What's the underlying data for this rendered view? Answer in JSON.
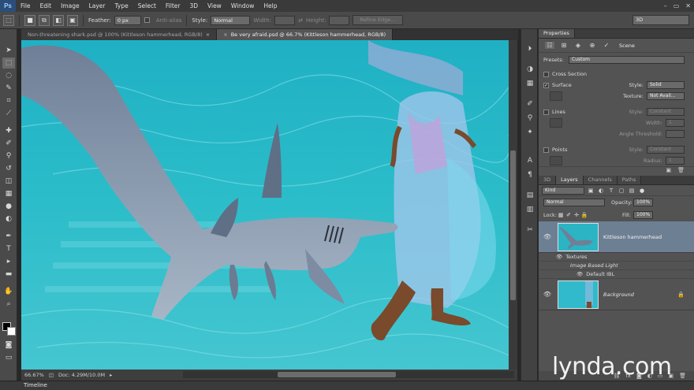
{
  "app": {
    "logo": "Ps"
  },
  "menu": [
    "File",
    "Edit",
    "Image",
    "Layer",
    "Type",
    "Select",
    "Filter",
    "3D",
    "View",
    "Window",
    "Help"
  ],
  "window_controls": [
    "–",
    "▭",
    "✕"
  ],
  "options": {
    "feather_label": "Feather:",
    "feather_value": "0 px",
    "antialias_label": "Anti-alias",
    "style_label": "Style:",
    "style_value": "Normal",
    "width_label": "Width:",
    "height_label": "Height:",
    "refine_edge": "Refine Edge...",
    "workspace": "3D"
  },
  "tabs": [
    {
      "label": "Non-threatening shark.psd @ 100% (Kittleson hammerhead, RGB/8)",
      "active": false
    },
    {
      "label": "Be very afraid.psd @ 66.7% (Kittleson hammerhead, RGB/8)",
      "active": true
    }
  ],
  "status": {
    "zoom": "66.67%",
    "doc": "Doc: 4.29M/10.0M"
  },
  "timeline_label": "Timeline",
  "properties": {
    "tab": "Properties",
    "mode_label": "Scene",
    "presets_label": "Presets:",
    "presets_value": "Custom",
    "cross_section": "Cross Section",
    "surface": "Surface",
    "surface_style_label": "Style:",
    "surface_style_value": "Solid",
    "texture_label": "Texture:",
    "texture_value": "Not Avail...",
    "lines": "Lines",
    "lines_style_label": "Style:",
    "lines_style_value": "Constant",
    "lines_width_label": "Width:",
    "lines_width_value": "1",
    "angle_threshold_label": "Angle Threshold:",
    "points": "Points",
    "points_style_label": "Style:",
    "points_style_value": "Constant",
    "points_radius_label": "Radius:",
    "points_radius_value": "1"
  },
  "layers_panel": {
    "tabs": [
      "3D",
      "Layers",
      "Channels",
      "Paths"
    ],
    "active_tab": "Layers",
    "filter_kind": "Kind",
    "blend_mode": "Normal",
    "opacity_label": "Opacity:",
    "opacity_value": "100%",
    "lock_label": "Lock:",
    "fill_label": "Fill:",
    "fill_value": "100%",
    "layers": [
      {
        "name": "Kittleson hammerhead",
        "selected": true
      },
      {
        "name": "Background",
        "selected": false
      }
    ],
    "sublayers": {
      "textures": "Textures",
      "ibl": "Image Based Light",
      "default_ibl": "Default IBL"
    }
  },
  "watermark": "lynda.com",
  "colors": {
    "accent_selected": "#6d7f93",
    "panel_bg": "#535353",
    "water": "#28b6c6"
  }
}
